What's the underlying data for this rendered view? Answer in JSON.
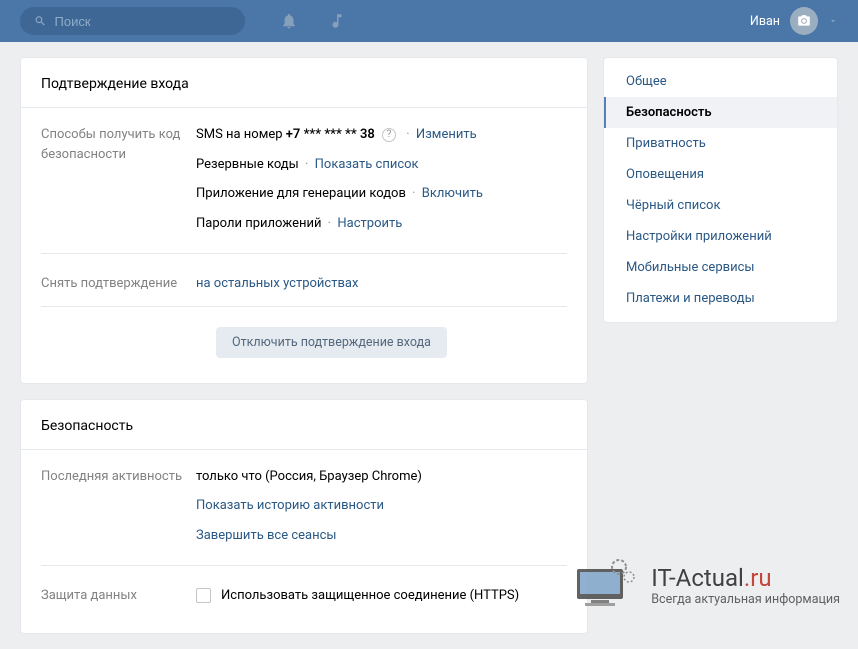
{
  "header": {
    "search_placeholder": "Поиск",
    "user_name": "Иван"
  },
  "sidebar": {
    "items": [
      {
        "label": "Общее"
      },
      {
        "label": "Безопасность",
        "active": true
      },
      {
        "label": "Приватность"
      },
      {
        "label": "Оповещения"
      },
      {
        "label": "Чёрный список"
      },
      {
        "label": "Настройки приложений"
      },
      {
        "label": "Мобильные сервисы"
      },
      {
        "label": "Платежи и переводы"
      }
    ]
  },
  "card1": {
    "title": "Подтверждение входа",
    "row_methods_label": "Способы получить код безопасности",
    "sms_prefix": "SMS на номер ",
    "sms_number": "+7 *** *** ** 38",
    "change": "Изменить",
    "backup_codes": "Резервные коды",
    "show_list": "Показать список",
    "codegen_app": "Приложение для генерации кодов",
    "enable": "Включить",
    "app_passwords": "Пароли приложений",
    "configure": "Настроить",
    "row_revoke_label": "Снять подтверждение",
    "revoke_link": "на остальных устройствах",
    "disable_button": "Отключить подтверждение входа"
  },
  "card2": {
    "title": "Безопасность",
    "last_activity_label": "Последняя активность",
    "last_activity_value": "только что (Россия, Браузер Chrome)",
    "show_history": "Показать историю активности",
    "end_sessions": "Завершить все сеансы",
    "data_protection_label": "Защита данных",
    "https_label": "Использовать защищенное соединение (HTTPS)"
  },
  "watermark": {
    "title_main": "IT-Actual",
    "title_dot": ".",
    "title_ext": "ru",
    "subtitle": "Всегда актуальная информация"
  }
}
